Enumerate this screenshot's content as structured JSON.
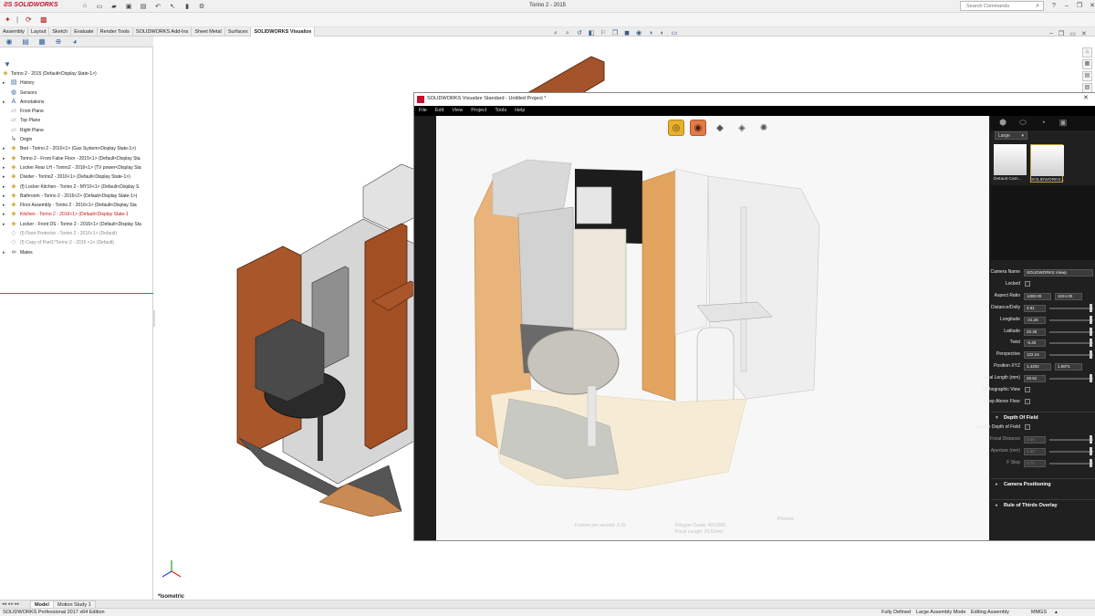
{
  "app": {
    "logo_text": "SOLIDWORKS",
    "document_title": "Torino 2 - 2015",
    "search_placeholder": "Search Commands"
  },
  "tabs": [
    {
      "label": "Assembly",
      "active": false
    },
    {
      "label": "Layout",
      "active": false
    },
    {
      "label": "Sketch",
      "active": false
    },
    {
      "label": "Evaluate",
      "active": false
    },
    {
      "label": "Render Tools",
      "active": false
    },
    {
      "label": "SOLIDWORKS Add-Ins",
      "active": false
    },
    {
      "label": "Sheet Metal",
      "active": false
    },
    {
      "label": "Surfaces",
      "active": false
    },
    {
      "label": "SOLIDWORKS Visualize",
      "active": true
    }
  ],
  "feature_tree": {
    "root": "Torino 2 - 2015  (Default<Display State-1>)",
    "items": [
      {
        "label": "History",
        "icon": "history-icon",
        "style": "normal",
        "expandable": true
      },
      {
        "label": "Sensors",
        "icon": "sensor-icon",
        "style": "normal",
        "expandable": false
      },
      {
        "label": "Annotations",
        "icon": "annotation-icon",
        "style": "normal",
        "expandable": true
      },
      {
        "label": "Front Plane",
        "icon": "plane-icon",
        "style": "normal",
        "expandable": false
      },
      {
        "label": "Top Plane",
        "icon": "plane-icon",
        "style": "normal",
        "expandable": false
      },
      {
        "label": "Right Plane",
        "icon": "plane-icon",
        "style": "normal",
        "expandable": false
      },
      {
        "label": "Origin",
        "icon": "origin-icon",
        "style": "normal",
        "expandable": false
      },
      {
        "label": "Bed - Torino 2 - 2016<1> (Gas System<Display State-1>)",
        "icon": "subassembly-icon",
        "style": "normal",
        "expandable": true
      },
      {
        "label": "Torino 2 - Front False Floor - 2015<1> (Default<Display Sta",
        "icon": "subassembly-icon",
        "style": "normal",
        "expandable": true
      },
      {
        "label": "Locker Rear LH - Torino2 - 2016<1> (TV power<Display Sta",
        "icon": "subassembly-icon",
        "style": "normal",
        "expandable": true
      },
      {
        "label": "Divider - Torino2 - 2016<1> (Default<Display State-1>)",
        "icon": "subassembly-icon",
        "style": "normal",
        "expandable": true
      },
      {
        "label": "(f) Locker Kitchen - Torino 2 - MY16<1> (Default<Display S",
        "icon": "subassembly-icon",
        "style": "normal",
        "expandable": true
      },
      {
        "label": "Bathroom - Torino 2 - 2016<2> (Default<Display State-1>)",
        "icon": "subassembly-icon",
        "style": "normal",
        "expandable": true
      },
      {
        "label": "Floor Assembly - Torino 2 - 2016<1> (Default<Display Sta",
        "icon": "subassembly-icon",
        "style": "normal",
        "expandable": true
      },
      {
        "label": "Kitchen - Torino 2 - 2016<1> (Default<Display State-1",
        "icon": "subassembly-icon",
        "style": "red",
        "expandable": true
      },
      {
        "label": "Locker - Front DS - Torino 2 - 2016<1> (Default<Display Sta",
        "icon": "subassembly-icon",
        "style": "normal",
        "expandable": true
      },
      {
        "label": "(f) Floor Protector - Torino 2 - 2016<1> (Default)",
        "icon": "part-icon",
        "style": "grey",
        "expandable": false
      },
      {
        "label": "(f) Copy of Part1^Torino 2 - 2015 <1> (Default)",
        "icon": "part-icon",
        "style": "grey",
        "expandable": false
      },
      {
        "label": "Mates",
        "icon": "mates-icon",
        "style": "normal",
        "expandable": true
      }
    ]
  },
  "viewport": {
    "view_label": "*Isometric"
  },
  "visualize": {
    "window_title": "SOLIDWORKS Visualize Standard - Untitled Project *",
    "menu": [
      "File",
      "Edit",
      "View",
      "Project",
      "Tools",
      "Help"
    ],
    "stats": {
      "fps": "Frames per second: 2.10",
      "polygon": "Polygon Count: 4913000",
      "focal": "Focal Length: 20.52mm",
      "preview": "Preview"
    },
    "size_dropdown": "Large",
    "cameras": [
      {
        "label": "Default Cam..."
      },
      {
        "label": "SOLIDWORKS..."
      }
    ],
    "properties": [
      {
        "label": "Camera Name",
        "value": "SOLIDWORKS Viewp",
        "type": "text"
      },
      {
        "label": "Locked",
        "type": "check"
      },
      {
        "label": "Aspect Ratio",
        "value": "1280.00",
        "value2": "1024.00",
        "type": "pair"
      },
      {
        "label": "Distance/Dolly",
        "value": "3.91",
        "type": "slider"
      },
      {
        "label": "Longitude",
        "value": "-21.26",
        "type": "slider"
      },
      {
        "label": "Latitude",
        "value": "20.36",
        "type": "slider"
      },
      {
        "label": "Twist",
        "value": "-5.40",
        "type": "slider"
      },
      {
        "label": "Perspective",
        "value": "122.24",
        "type": "slider"
      },
      {
        "label": "Position XYZ",
        "value": "1.4202",
        "value2": "1.9871",
        "type": "pair"
      },
      {
        "label": "Focal Length (mm)",
        "value": "20.52",
        "type": "slider"
      },
      {
        "label": "Orthographic View",
        "type": "check"
      },
      {
        "label": "Keep Above Floor",
        "type": "check"
      }
    ],
    "dof_section": "Depth Of Field",
    "dof_properties": [
      {
        "label": "Enable Depth of Field",
        "type": "check"
      },
      {
        "label": "Focal Distance",
        "value": "0.00",
        "type": "slider"
      },
      {
        "label": "Aperture (mm)",
        "value": "4.30",
        "type": "slider"
      },
      {
        "label": "F Stop",
        "value": "5.74",
        "type": "slider"
      }
    ],
    "sections": [
      "Camera Positioning",
      "Rule of Thirds Overlay"
    ]
  },
  "bottom_tabs": [
    {
      "label": "Model",
      "active": true
    },
    {
      "label": "Motion Study 1",
      "active": false
    }
  ],
  "status": {
    "edition": "SOLIDWORKS Professional 2017 x64 Edition",
    "defined": "Fully Defined",
    "mode": "Large Assembly Mode",
    "editing": "Editing Assembly",
    "units": "MMGS"
  },
  "colors": {
    "brand_red": "#c8102e",
    "wood": "#a8562a",
    "selection_blue": "#3a78c4"
  }
}
